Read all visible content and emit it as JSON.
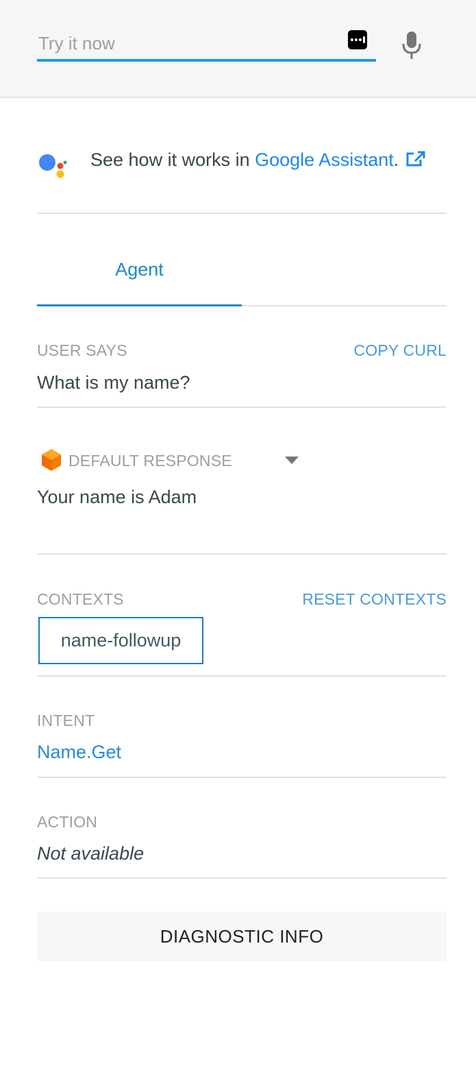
{
  "search": {
    "placeholder": "Try it now",
    "keyboard_icon": "keyboard-icon",
    "mic_icon": "mic-icon"
  },
  "assistant": {
    "prefix": "See how it works in ",
    "link_text": "Google Assistant",
    "suffix": ".",
    "logo_icon": "google-assistant-logo",
    "external_icon": "external-link-icon"
  },
  "tabs": [
    {
      "label": "Agent",
      "active": true
    }
  ],
  "user_says": {
    "label": "USER SAYS",
    "action_label": "COPY CURL",
    "value": "What is my name?"
  },
  "response": {
    "icon": "cube-icon",
    "label": "DEFAULT RESPONSE",
    "dropdown_icon": "caret-down-icon",
    "value": "Your name is Adam"
  },
  "contexts": {
    "label": "CONTEXTS",
    "action_label": "RESET CONTEXTS",
    "items": [
      "name-followup"
    ]
  },
  "intent": {
    "label": "INTENT",
    "value": "Name.Get"
  },
  "action": {
    "label": "ACTION",
    "value": "Not available"
  },
  "diagnostic": {
    "label": "DIAGNOSTIC INFO"
  },
  "colors": {
    "accent": "#1e88c7",
    "input_underline": "#1e9be0",
    "link": "#1e88e5",
    "muted_label": "#9e9e9e",
    "text": "#37474f",
    "divider": "#e2e2e2",
    "top_bar_bg": "#f6f6f6"
  }
}
